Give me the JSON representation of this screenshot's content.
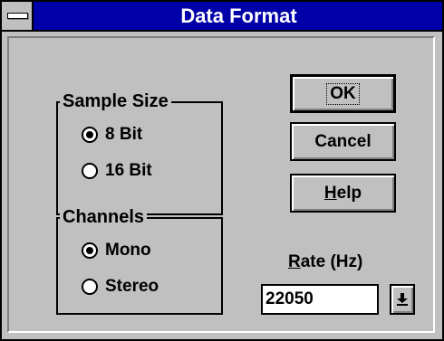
{
  "window": {
    "title": "Data Format"
  },
  "sample_size": {
    "label": "Sample Size",
    "options": [
      {
        "label": "8 Bit",
        "selected": true
      },
      {
        "label": "16 Bit",
        "selected": false
      }
    ]
  },
  "channels": {
    "label": "Channels",
    "options": [
      {
        "label": "Mono",
        "selected": true
      },
      {
        "label": "Stereo",
        "selected": false
      }
    ]
  },
  "buttons": {
    "ok": "OK",
    "cancel": "Cancel",
    "help_mnemonic": "H",
    "help_rest": "elp"
  },
  "rate": {
    "label_mnemonic": "R",
    "label_rest": "ate (Hz)",
    "value": "22050"
  },
  "icons": {
    "system_menu": "system-menu-icon",
    "dropdown": "down-arrow-icon"
  }
}
